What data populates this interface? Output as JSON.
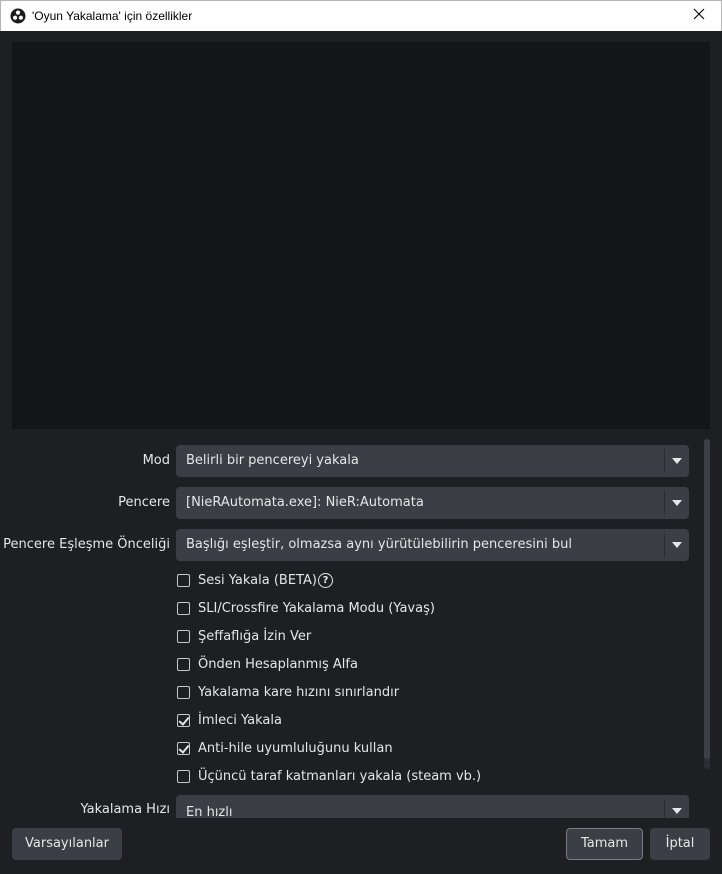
{
  "window": {
    "title": "'Oyun Yakalama' için özellikler",
    "app_icon": "obs-logo-icon",
    "close_icon": "close-icon"
  },
  "properties": {
    "mode": {
      "label": "Mod",
      "value": "Belirli bir pencereyi yakala"
    },
    "window": {
      "label": "Pencere",
      "value": "[NieRAutomata.exe]: NieR:Automata"
    },
    "match_priority": {
      "label": "Pencere Eşleşme Önceliği",
      "value": "Başlığı eşleştir, olmazsa aynı yürütülebilirin penceresini bul"
    },
    "checkboxes": [
      {
        "label": "Sesi Yakala (BETA)",
        "checked": false,
        "help": true
      },
      {
        "label": "SLI/Crossfire Yakalama Modu (Yavaş)",
        "checked": false
      },
      {
        "label": "Şeffaflığa İzin Ver",
        "checked": false
      },
      {
        "label": "Önden Hesaplanmış Alfa",
        "checked": false
      },
      {
        "label": "Yakalama kare hızını sınırlandır",
        "checked": false
      },
      {
        "label": "İmleci Yakala",
        "checked": true
      },
      {
        "label": "Anti-hile uyumluluğunu kullan",
        "checked": true
      },
      {
        "label": "Üçüncü taraf katmanları yakala (steam vb.)",
        "checked": false
      }
    ],
    "capture_rate": {
      "label": "Yakalama Hızı",
      "value": "En hızlı"
    },
    "help_icon_glyph": "?"
  },
  "footer": {
    "defaults_label": "Varsayılanlar",
    "ok_label": "Tamam",
    "cancel_label": "İptal"
  },
  "colors": {
    "background": "#1e1f22",
    "preview": "#141518",
    "control": "#3b3e45",
    "text": "#e6e6e6"
  }
}
